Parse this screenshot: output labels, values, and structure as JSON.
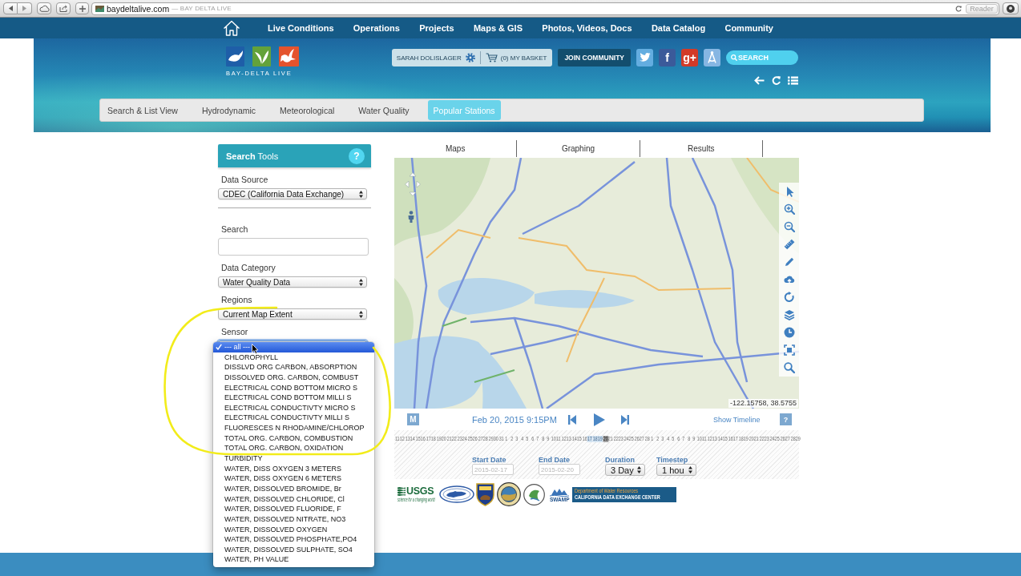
{
  "browser": {
    "url": "baydeltalive.com",
    "page_title": "— BAY DELTA LIVE",
    "reader": "Reader"
  },
  "nav": {
    "items": [
      {
        "label": "Live Conditions"
      },
      {
        "label": "Operations"
      },
      {
        "label": "Projects"
      },
      {
        "label": "Maps & GIS"
      },
      {
        "label": "Photos, Videos, Docs"
      },
      {
        "label": "Data Catalog"
      },
      {
        "label": "Community"
      }
    ]
  },
  "header": {
    "logo_text": "BAY-DELTA LIVE",
    "user": "SARAH DOLISLAGER",
    "basket": "(0) MY BASKET",
    "join": "JOIN COMMUNITY",
    "social": [
      {
        "kind": "bird",
        "color": "#63ade0"
      },
      {
        "kind": "letter",
        "text": "f",
        "color": "#3b5a9a"
      },
      {
        "kind": "letter",
        "text": "g+",
        "color": "#d23a28"
      },
      {
        "kind": "compass",
        "color": "#86b6e3"
      }
    ],
    "search": {
      "placeholder": "SEARCH"
    }
  },
  "tabs": [
    {
      "label": "Search & List View",
      "selected": false
    },
    {
      "label": "Hydrodynamic",
      "selected": false
    },
    {
      "label": "Meteorological",
      "selected": false
    },
    {
      "label": "Water Quality",
      "selected": false
    },
    {
      "label": "Popular Stations",
      "selected": true
    }
  ],
  "search_tools": {
    "title": "**Search** Tools",
    "help": "?",
    "fields": [
      {
        "kind": "select",
        "label": "Data Source",
        "value": "CDEC (California Data Exchange)",
        "expanded": false,
        "divider_after": true
      },
      {
        "kind": "input",
        "label": "Search",
        "divider_after": false
      },
      {
        "kind": "select",
        "label": "Data Category",
        "value": "Water Quality Data",
        "expanded": false,
        "divider_after": false
      },
      {
        "kind": "select",
        "label": "Regions",
        "value": "Current Map Extent",
        "expanded": false,
        "divider_after": false
      },
      {
        "kind": "select",
        "label": "Sensor",
        "expanded": true,
        "divider_after": false,
        "options": [
          {
            "label": "--- all ---",
            "selected": true
          },
          {
            "label": "CHLOROPHYLL",
            "selected": false
          },
          {
            "label": "DISSLVD ORG CARBON, ABSORPTION",
            "selected": false
          },
          {
            "label": "DISSOLVED ORG. CARBON, COMBUST",
            "selected": false
          },
          {
            "label": "ELECTRICAL COND BOTTOM MICRO S",
            "selected": false
          },
          {
            "label": "ELECTRICAL COND BOTTOM MILLI S",
            "selected": false
          },
          {
            "label": "ELECTRICAL CONDUCTIVTY MICRO S",
            "selected": false
          },
          {
            "label": "ELECTRICAL CONDUCTIVTY MILLI S",
            "selected": false
          },
          {
            "label": "FLUORESCES N RHODAMINE/CHLOROP",
            "selected": false
          },
          {
            "label": "TOTAL ORG. CARBON, COMBUSTION",
            "selected": false
          },
          {
            "label": "TOTAL ORG. CARBON, OXIDATION",
            "selected": false
          },
          {
            "label": "TURBIDITY",
            "selected": false
          },
          {
            "label": "WATER, DISS OXYGEN 3 METERS",
            "selected": false
          },
          {
            "label": "WATER, DISS OXYGEN 6 METERS",
            "selected": false
          },
          {
            "label": "WATER, DISSOLVED BROMIDE, Br",
            "selected": false
          },
          {
            "label": "WATER, DISSOLVED CHLORIDE, Cl",
            "selected": false
          },
          {
            "label": "WATER, DISSOLVED FLUORIDE, F",
            "selected": false
          },
          {
            "label": "WATER, DISSOLVED NITRATE, NO3",
            "selected": false
          },
          {
            "label": "WATER, DISSOLVED OXYGEN",
            "selected": false
          },
          {
            "label": "WATER, DISSOLVED PHOSPHATE,PO4",
            "selected": false
          },
          {
            "label": "WATER, DISSOLVED SULPHATE, SO4",
            "selected": false
          },
          {
            "label": "WATER, PH VALUE",
            "selected": false
          }
        ]
      }
    ]
  },
  "map": {
    "tabs": [
      {
        "label": "Maps"
      },
      {
        "label": "Graphing"
      },
      {
        "label": "Results"
      }
    ],
    "coordinates": "-122.15758, 38.5755"
  },
  "timeline": {
    "mode": "M",
    "datetime": "Feb 20, 2015 9:15PM",
    "show": "Show Timeline",
    "help": "?",
    "segments": [
      {
        "kind": "plain",
        "days": [
          "11",
          "12",
          "13",
          "14",
          "15",
          "16",
          "17",
          "18",
          "19",
          "20",
          "21",
          "22",
          "23",
          "24",
          "25",
          "26",
          "27",
          "28",
          "29",
          "30",
          "31",
          "1",
          "2",
          "3",
          "4",
          "5",
          "6",
          "7",
          "8",
          "9",
          "10",
          "11",
          "12",
          "13",
          "14",
          "15",
          "16"
        ]
      },
      {
        "kind": "range",
        "days": [
          "17",
          "18",
          "19"
        ]
      },
      {
        "kind": "current",
        "days": [
          "20"
        ]
      },
      {
        "kind": "plain",
        "days": [
          "21",
          "22",
          "23",
          "24",
          "25",
          "26",
          "27",
          "28",
          "1",
          "2",
          "3",
          "4",
          "5",
          "6",
          "7",
          "8",
          "9",
          "10",
          "11",
          "12",
          "13",
          "14",
          "15",
          "16",
          "17",
          "18",
          "19",
          "20",
          "21",
          "22",
          "23",
          "24",
          "25",
          "26",
          "27",
          "28",
          "29"
        ]
      }
    ]
  },
  "dates": [
    {
      "kind": "input",
      "label": "Start Date",
      "placeholder": "2015-02-17"
    },
    {
      "kind": "input",
      "label": "End Date",
      "placeholder": "2015-02-20"
    },
    {
      "kind": "select",
      "label": "Duration",
      "value": "3 Day"
    },
    {
      "kind": "select",
      "label": "Timestep",
      "value": "1 hou"
    }
  ],
  "partners": {
    "usgs": "USGS",
    "usgs_tagline": "science for a changing world",
    "swamp": "SWAMP",
    "agency": "Department of Water Resources",
    "center": "CALIFORNIA DATA EXCHANGE CENTER"
  }
}
